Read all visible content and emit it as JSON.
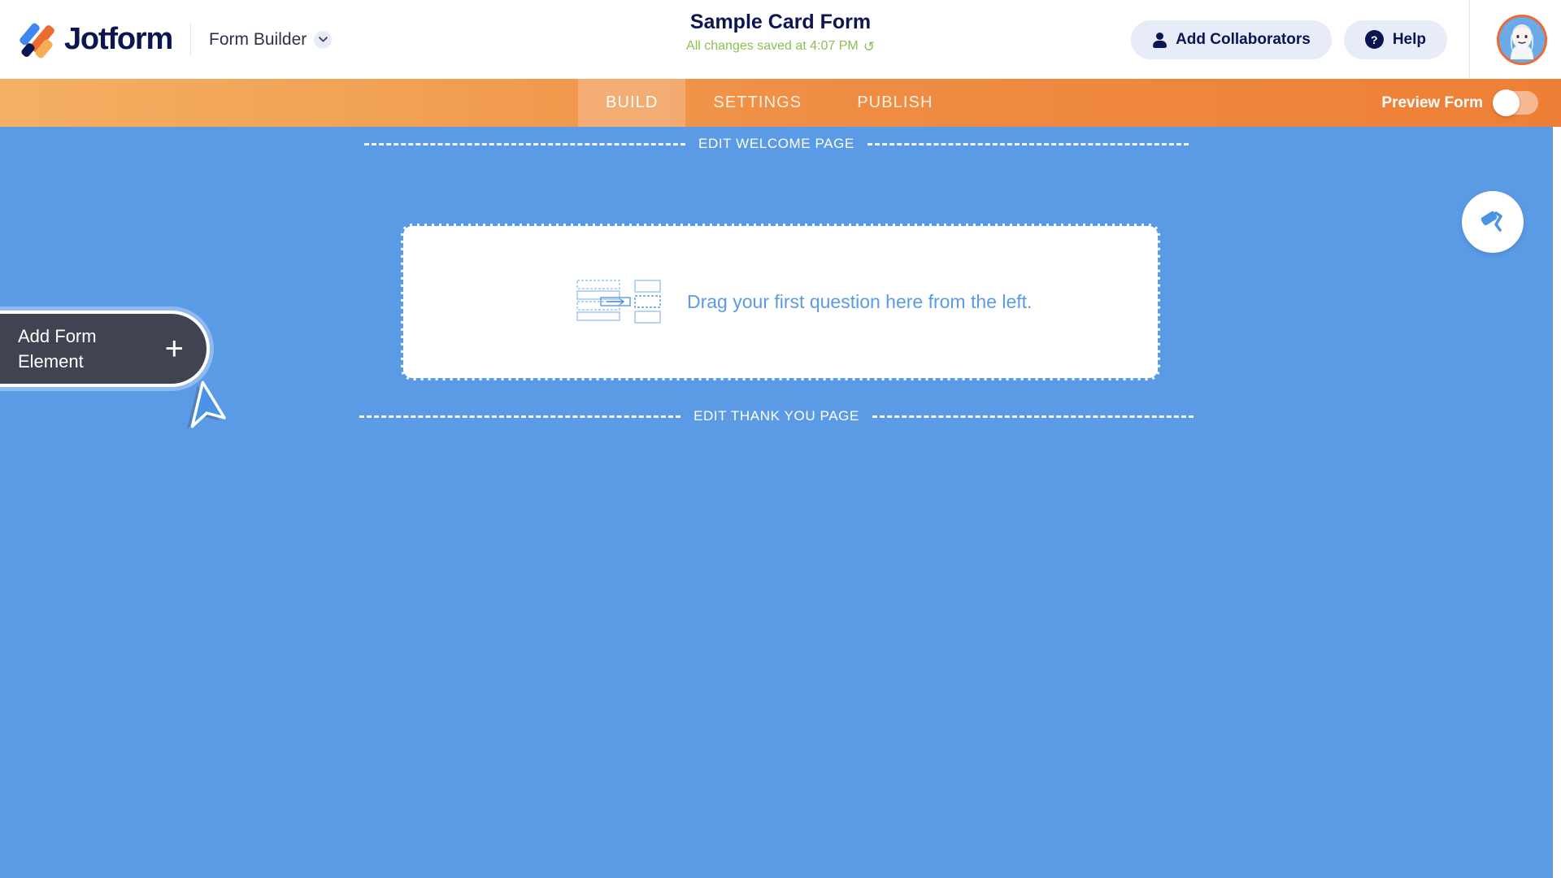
{
  "header": {
    "logo_text": "Jotform",
    "logo_icon": "jotform-logo-icon",
    "product_label": "Form Builder",
    "product_chevron_icon": "chevron-down-icon",
    "form_title": "Sample Card Form",
    "save_status": "All changes saved at 4:07 PM",
    "undo_icon": "↺",
    "add_collaborators_label": "Add Collaborators",
    "add_collaborators_icon": "person-icon",
    "help_label": "Help",
    "help_icon": "question-circle-icon",
    "avatar_icon": "user-avatar"
  },
  "navbar": {
    "tabs": [
      {
        "label": "BUILD",
        "active": true
      },
      {
        "label": "SETTINGS",
        "active": false
      },
      {
        "label": "PUBLISH",
        "active": false
      }
    ],
    "preview_label": "Preview Form",
    "preview_toggle_state": "off"
  },
  "canvas": {
    "welcome_divider": "EDIT WELCOME PAGE",
    "thankyou_divider": "EDIT THANK YOU PAGE",
    "drop_text": "Drag your first question here from the left.",
    "drag_icon": "drag-question-icon",
    "add_element_label": "Add Form\nElement",
    "add_element_plus_icon": "plus-icon",
    "cursor_icon": "arrow-cursor",
    "designer_fab_icon": "paint-roller-icon"
  },
  "colors": {
    "canvas_blue": "#5b9ae5",
    "brand_navy": "#0a1551",
    "accent_orange": "#ed6a32",
    "save_green": "#8cc152",
    "nav_orange_start": "#f4b063",
    "nav_orange_end": "#ee7f36",
    "dark_pill": "#3f4450"
  }
}
